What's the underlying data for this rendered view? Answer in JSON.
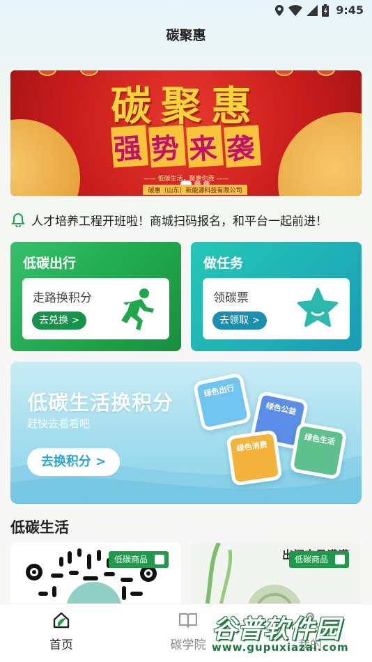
{
  "status_bar": {
    "time": "9:45"
  },
  "header": {
    "title": "碳聚惠"
  },
  "banner": {
    "main_text": "碳聚惠",
    "sub_chars": [
      "强",
      "势",
      "来",
      "袭"
    ],
    "tagline": "—— 低碳生活，聚惠你我 ——",
    "company": "碳惠（山东）新能源科技有限公司"
  },
  "notice": {
    "text": "人才培养工程开班啦！商城扫码报名，和平台一起前进！"
  },
  "cards": [
    {
      "title": "低碳出行",
      "label": "走路换积分",
      "button": "去兑换 >",
      "icon": "running-person-icon"
    },
    {
      "title": "做任务",
      "label": "领碳票",
      "button": "去领取 >",
      "icon": "star-icon"
    }
  ],
  "promo": {
    "title": "低碳生活换积分",
    "subtitle": "赶快去看看吧",
    "button": "去换积分 >",
    "tiles": [
      "绿色出行",
      "绿色公益",
      "绿色消费",
      "绿色生活"
    ]
  },
  "section": {
    "title": "低碳生活"
  },
  "products": [
    {
      "tag": "低碳商品"
    },
    {
      "tag": "低碳商品",
      "caption": "出门电量满满"
    }
  ],
  "tabbar": {
    "items": [
      {
        "label": "首页"
      },
      {
        "label": "碳学院"
      },
      {
        "label": "我的"
      }
    ]
  },
  "watermark": {
    "brand": "谷普软件园",
    "url": "www.gupuxiazai.com"
  },
  "colors": {
    "primary_green": "#1ea54a",
    "teal": "#1fb3b5",
    "accent_blue": "#23a6d4"
  }
}
